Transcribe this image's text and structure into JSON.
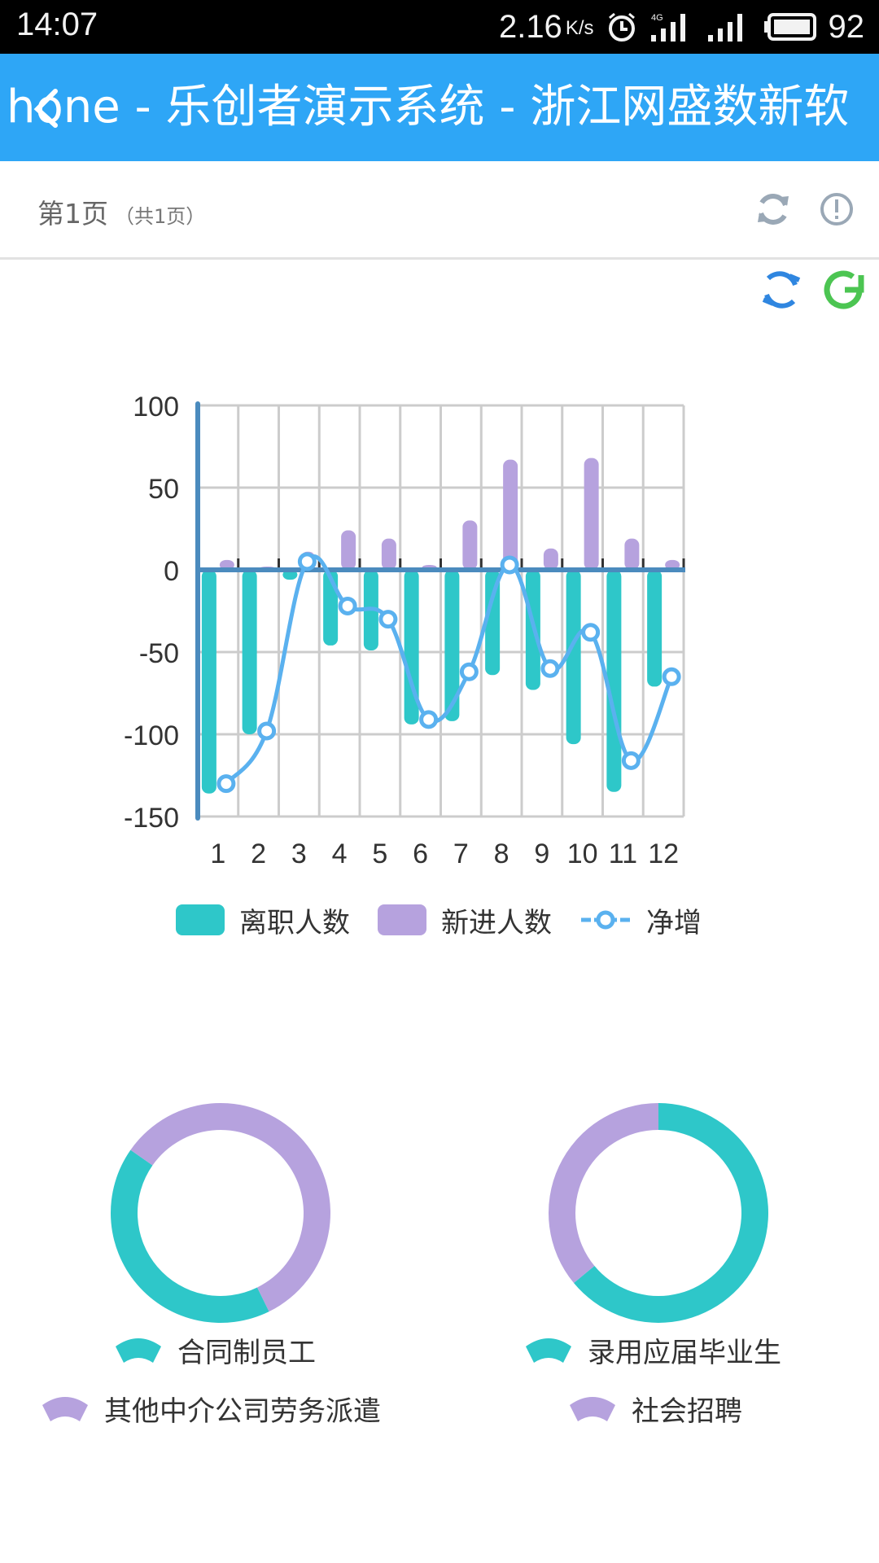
{
  "status_bar": {
    "time": "14:07",
    "net_speed": "2.16",
    "net_unit": "K/s",
    "icons": [
      "alarm-icon",
      "signal-4g-icon",
      "signal-icon",
      "battery-icon"
    ],
    "battery_percent": "92"
  },
  "title_bar": {
    "title": "hone - 乐创者演示系统 - 浙江网盛数新软",
    "back_icon": "back-chevron-icon",
    "color": "#2ea6f6"
  },
  "toolbar": {
    "page_label": "第1页",
    "page_total": "（共1页）",
    "refresh_icon": "refresh-icon",
    "info_icon": "info-icon"
  },
  "chart_actions": {
    "icons": [
      "sync-icon",
      "reload-icon"
    ]
  },
  "colors": {
    "leave": "#2ec7c9",
    "new": "#b6a2de",
    "net": "#5ab1ef",
    "axis": "#4b8bbe",
    "grid": "#cccccc"
  },
  "chart_data": [
    {
      "type": "bar",
      "title": "",
      "xlabel": "",
      "ylabel": "",
      "categories": [
        "1",
        "2",
        "3",
        "4",
        "5",
        "6",
        "7",
        "8",
        "9",
        "10",
        "11",
        "12"
      ],
      "ylim": [
        -150,
        100
      ],
      "yticks": [
        100,
        50,
        0,
        -50,
        -100,
        -150
      ],
      "grid": true,
      "legend_position": "bottom",
      "series": [
        {
          "name": "离职人数",
          "type": "bar",
          "values": [
            -136,
            -100,
            -6,
            -46,
            -49,
            -94,
            -92,
            -64,
            -73,
            -106,
            -135,
            -71
          ]
        },
        {
          "name": "新进人数",
          "type": "bar",
          "values": [
            6,
            2,
            11,
            24,
            19,
            3,
            30,
            67,
            13,
            68,
            19,
            6
          ]
        },
        {
          "name": "净增",
          "type": "line",
          "values": [
            -130,
            -98,
            5,
            -22,
            -30,
            -91,
            -62,
            3,
            -60,
            -38,
            -116,
            -65
          ]
        }
      ]
    },
    {
      "type": "pie",
      "subtype": "donut",
      "labels": [
        "合同制员工",
        "其他中介公司劳务派遣"
      ],
      "values": [
        42,
        58
      ]
    },
    {
      "type": "pie",
      "subtype": "donut",
      "labels": [
        "录用应届毕业生",
        "社会招聘"
      ],
      "values": [
        64,
        36
      ]
    }
  ]
}
